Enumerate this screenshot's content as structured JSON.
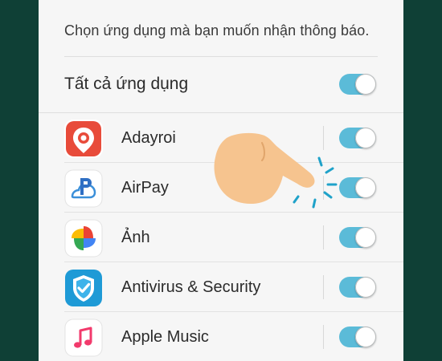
{
  "description": "Chọn ứng dụng mà bạn muốn nhận thông báo.",
  "all_apps": {
    "label": "Tất cả ứng dụng",
    "enabled": true
  },
  "apps": [
    {
      "name": "Adayroi",
      "icon": "adayroi-icon",
      "enabled": true
    },
    {
      "name": "AirPay",
      "icon": "airpay-icon",
      "enabled": true
    },
    {
      "name": "Ảnh",
      "icon": "photos-icon",
      "enabled": true
    },
    {
      "name": "Antivirus & Security",
      "icon": "antivirus-shield-icon",
      "enabled": true
    },
    {
      "name": "Apple Music",
      "icon": "apple-music-icon",
      "enabled": true
    }
  ],
  "colors": {
    "background": "#0f4036",
    "panel": "#f6f6f6",
    "toggle_on": "#5bbbd8",
    "adayroi": "#e84b3a",
    "antivirus": "#1e9ad6"
  }
}
